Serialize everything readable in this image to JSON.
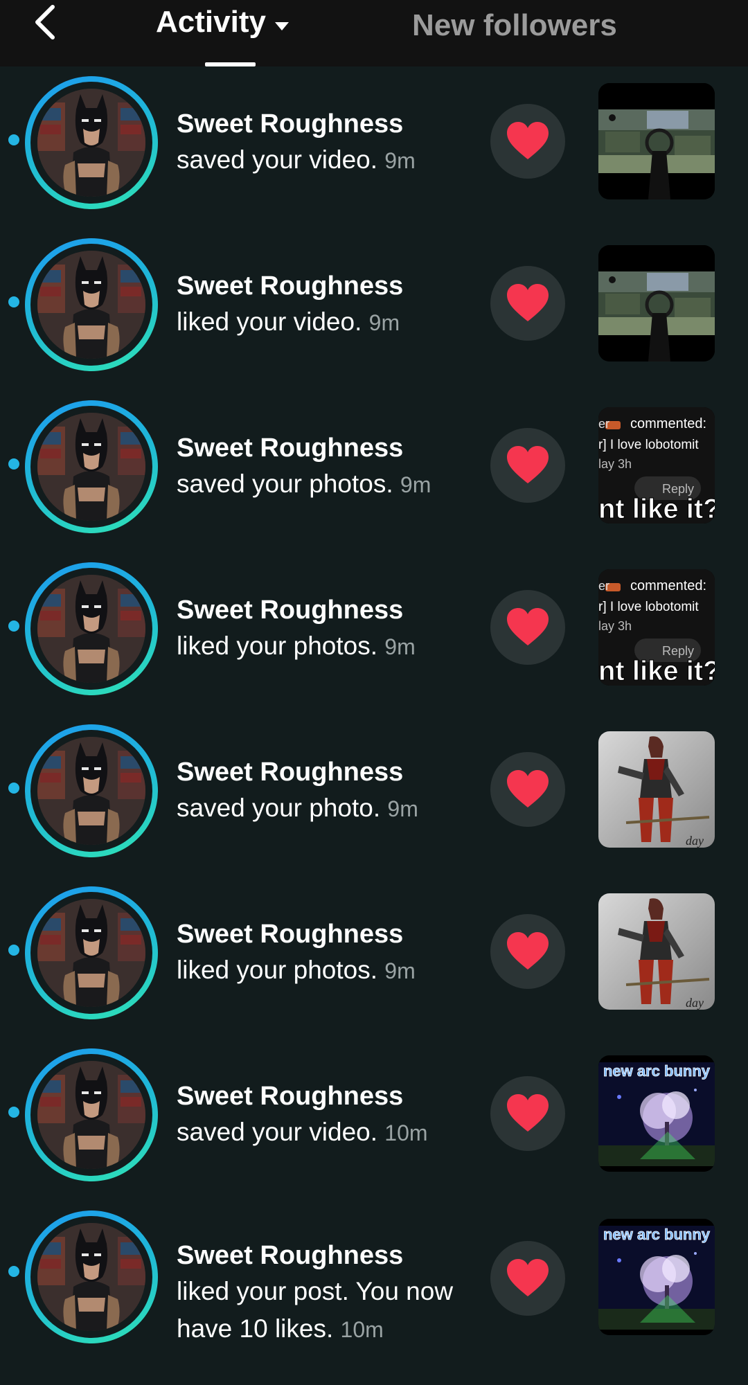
{
  "header": {
    "active_tab": "Activity",
    "other_tab": "New followers"
  },
  "notifications": [
    {
      "username": "Sweet Roughness",
      "action": "saved your video.",
      "time": "9m",
      "thumbnail": "game-scope-video"
    },
    {
      "username": "Sweet Roughness",
      "action": "liked your video.",
      "time": "9m",
      "thumbnail": "game-scope-video"
    },
    {
      "username": "Sweet Roughness",
      "action": "saved your photos.",
      "time": "9m",
      "thumbnail": "comment-screenshot"
    },
    {
      "username": "Sweet Roughness",
      "action": "liked your photos.",
      "time": "9m",
      "thumbnail": "comment-screenshot"
    },
    {
      "username": "Sweet Roughness",
      "action": "saved your photo.",
      "time": "9m",
      "thumbnail": "character-render"
    },
    {
      "username": "Sweet Roughness",
      "action": "liked your photos.",
      "time": "9m",
      "thumbnail": "character-render"
    },
    {
      "username": "Sweet Roughness",
      "action": "saved your video.",
      "time": "10m",
      "thumbnail": "night-tree-video"
    },
    {
      "username": "Sweet Roughness",
      "action": "liked your post. You now have 10 likes.",
      "time": "10m",
      "thumbnail": "night-tree-video"
    }
  ],
  "thumb_text": {
    "comment_line1": "commented:",
    "comment_line2": "r] I love lobotomit",
    "comment_line3": "lay 3h",
    "comment_reply": "Reply",
    "comment_big": "nt like it?",
    "character_caption": "day",
    "tree_caption": "new arc bunny"
  },
  "colors": {
    "background": "#121c1d",
    "topbar": "#121212",
    "unread_dot": "#24b5e4",
    "heart": "#f5364f",
    "avatar_ring_start": "#1e9bf0",
    "avatar_ring_end": "#2fe3b5"
  }
}
